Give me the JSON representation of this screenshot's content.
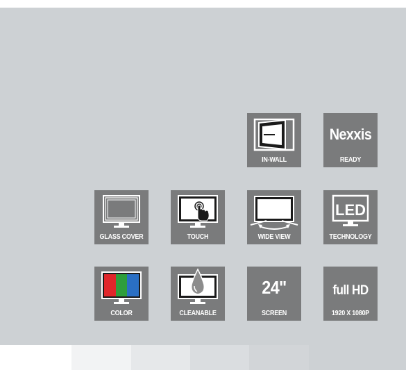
{
  "tiles": {
    "in_wall": {
      "label": "IN-WALL",
      "icon": "in-wall-icon"
    },
    "nexxis": {
      "title": "Nexxis",
      "label": "READY"
    },
    "glass_cover": {
      "label": "GLASS COVER",
      "icon": "glass-cover-monitor-icon"
    },
    "touch": {
      "label": "TOUCH",
      "icon": "touch-monitor-icon"
    },
    "wide_view": {
      "label": "WIDE VIEW",
      "icon": "wide-view-monitor-icon"
    },
    "led": {
      "title": "LED",
      "label": "TECHNOLOGY",
      "icon": "led-monitor-icon"
    },
    "color": {
      "label": "COLOR",
      "icon": "color-monitor-icon"
    },
    "cleanable": {
      "label": "CLEANABLE",
      "icon": "cleanable-monitor-icon"
    },
    "screen": {
      "title": "24\"",
      "label": "SCREEN"
    },
    "full_hd": {
      "title": "full HD",
      "label": "1920 X 1080P"
    }
  },
  "colors": {
    "panel": "#cdd1d4",
    "tile": "#7a7b7c",
    "text": "#ffffff",
    "rgb_red": "#e0262a",
    "rgb_green": "#2e9e3c",
    "rgb_blue": "#2a6fc4",
    "swatches": [
      "#f2f3f4",
      "#e6e8ea",
      "#dadde0",
      "#d2d5d8"
    ]
  }
}
